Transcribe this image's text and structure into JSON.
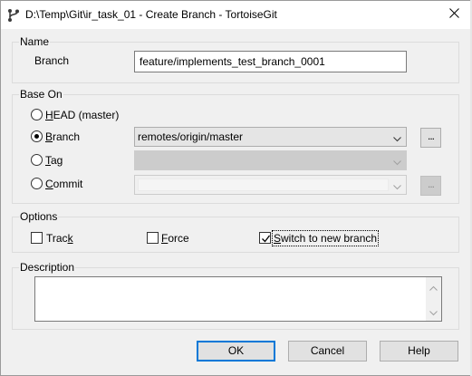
{
  "window": {
    "title": "D:\\Temp\\Git\\ir_task_01 - Create Branch - TortoiseGit"
  },
  "name_group": {
    "label": "Name",
    "branch_label": "Branch",
    "branch_value": "feature/implements_test_branch_0001"
  },
  "base_on_group": {
    "label": "Base On",
    "head_label": "HEAD (master)",
    "branch_label": "Branch",
    "branch_value": "remotes/origin/master",
    "branch_browse_label": "...",
    "tag_label": "Tag",
    "tag_value": "",
    "commit_label": "Commit",
    "commit_value": "",
    "commit_browse_label": "...",
    "selected": "branch"
  },
  "options_group": {
    "label": "Options",
    "track_label": "Track",
    "track_checked": false,
    "force_label": "Force",
    "force_checked": false,
    "switch_label": "Switch to new branch",
    "switch_checked": true
  },
  "description_group": {
    "label": "Description",
    "value": ""
  },
  "buttons": {
    "ok": "OK",
    "cancel": "Cancel",
    "help": "Help"
  },
  "colors": {
    "accent": "#0078d7",
    "dialog_bg": "#f0f0f0"
  },
  "icons": {
    "title": "tortoisegit-branch-icon",
    "close": "close-icon",
    "dropdown": "chevron-down-icon"
  }
}
